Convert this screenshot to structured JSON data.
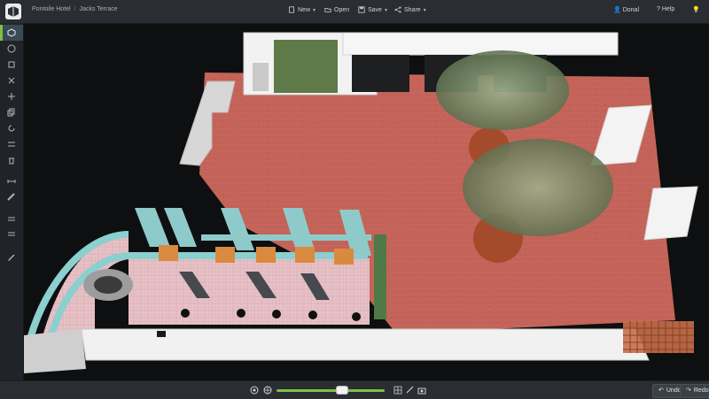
{
  "breadcrumb": {
    "project": "Pontoile Hotel",
    "separator": "/",
    "page": "Jacks Terrace"
  },
  "menus": {
    "new": "New",
    "open": "Open",
    "save": "Save",
    "share": "Share"
  },
  "user": {
    "name": "Donal",
    "help": "Help"
  },
  "toolbar": {
    "undo": "Undo",
    "redo": "Redo"
  },
  "colors": {
    "topbar": "#2a2e32",
    "sidebar": "#202428",
    "accent": "#7fbf3f",
    "floor": "#c7665b"
  },
  "icons": [
    "logo-icon",
    "new-icon",
    "open-icon",
    "save-icon",
    "share-icon",
    "user-icon",
    "help-icon",
    "bulb-icon"
  ]
}
